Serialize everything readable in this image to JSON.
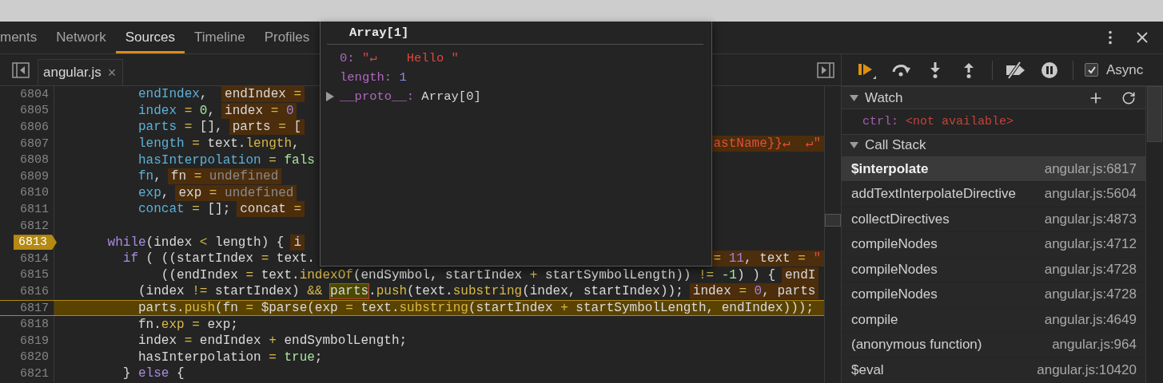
{
  "tabs": [
    {
      "label": "ments",
      "selected": false
    },
    {
      "label": "Network",
      "selected": false
    },
    {
      "label": "Sources",
      "selected": true
    },
    {
      "label": "Timeline",
      "selected": false
    },
    {
      "label": "Profiles",
      "selected": false
    }
  ],
  "file_tab": {
    "name": "angular.js",
    "close": "×"
  },
  "code": [
    {
      "number": "6804",
      "parts": [
        {
          "text": "          endIndex",
          "kind": "decl"
        },
        {
          "text": ", ",
          "kind": "plain"
        },
        {
          "kind": "inline",
          "parts": [
            {
              "text": "endIndex ",
              "kind": "plain"
            },
            {
              "text": "=",
              "kind": "op"
            }
          ]
        }
      ]
    },
    {
      "number": "6805",
      "parts": [
        {
          "text": "          index",
          "kind": "decl"
        },
        {
          "text": " = ",
          "kind": "op"
        },
        {
          "text": "0",
          "kind": "num"
        },
        {
          "text": ",",
          "kind": "plain"
        },
        {
          "kind": "inline",
          "parts": [
            {
              "text": "index ",
              "kind": "plain"
            },
            {
              "text": "= ",
              "kind": "op"
            },
            {
              "text": "0",
              "kind": "inum"
            }
          ]
        }
      ]
    },
    {
      "number": "6806",
      "parts": [
        {
          "text": "          parts",
          "kind": "decl"
        },
        {
          "text": " = ",
          "kind": "op"
        },
        {
          "text": "[],",
          "kind": "plain"
        },
        {
          "kind": "inline",
          "parts": [
            {
              "text": "parts ",
              "kind": "plain"
            },
            {
              "text": "= ",
              "kind": "op"
            },
            {
              "text": "[",
              "kind": "plain"
            }
          ]
        }
      ]
    },
    {
      "number": "6807",
      "parts": [
        {
          "text": "          length",
          "kind": "decl"
        },
        {
          "text": " = ",
          "kind": "op"
        },
        {
          "text": "text.",
          "kind": "plain"
        },
        {
          "text": "length",
          "kind": "prop"
        },
        {
          "text": ",",
          "kind": "plain"
        }
      ],
      "tail": [
        {
          "kind": "inline",
          "parts": [
            {
              "text": "astName}}↵  ↵\"",
              "kind": "str"
            }
          ]
        }
      ]
    },
    {
      "number": "6808",
      "parts": [
        {
          "text": "          hasInterpolation",
          "kind": "decl"
        },
        {
          "text": " = ",
          "kind": "op"
        },
        {
          "text": "fals",
          "kind": "bool"
        }
      ]
    },
    {
      "number": "6809",
      "parts": [
        {
          "text": "          fn",
          "kind": "decl"
        },
        {
          "text": ",",
          "kind": "plain"
        },
        {
          "kind": "inline",
          "parts": [
            {
              "text": "fn ",
              "kind": "plain"
            },
            {
              "text": "= ",
              "kind": "op"
            },
            {
              "text": "undefined",
              "kind": "undef"
            }
          ]
        }
      ]
    },
    {
      "number": "6810",
      "parts": [
        {
          "text": "          exp",
          "kind": "decl"
        },
        {
          "text": ",",
          "kind": "plain"
        },
        {
          "kind": "inline",
          "parts": [
            {
              "text": "exp ",
              "kind": "plain"
            },
            {
              "text": "= ",
              "kind": "op"
            },
            {
              "text": "undefined",
              "kind": "undef"
            }
          ]
        }
      ]
    },
    {
      "number": "6811",
      "parts": [
        {
          "text": "          concat",
          "kind": "decl"
        },
        {
          "text": " = ",
          "kind": "op"
        },
        {
          "text": "[];",
          "kind": "plain"
        },
        {
          "kind": "inline",
          "parts": [
            {
              "text": "concat ",
              "kind": "plain"
            },
            {
              "text": "=",
              "kind": "op"
            }
          ]
        }
      ]
    },
    {
      "number": "6812"
    },
    {
      "number": "6813",
      "breakpoint": true,
      "parts": [
        {
          "text": "      while",
          "kind": "kw"
        },
        {
          "text": "(index ",
          "kind": "plain"
        },
        {
          "text": "< ",
          "kind": "op"
        },
        {
          "text": "length) {",
          "kind": "plain"
        },
        {
          "kind": "inline",
          "parts": [
            {
              "text": "i",
              "kind": "plain"
            }
          ]
        }
      ]
    },
    {
      "number": "6814",
      "parts": [
        {
          "text": "        if",
          "kind": "kw"
        },
        {
          "text": " ( ((startIndex ",
          "kind": "plain"
        },
        {
          "text": "= ",
          "kind": "op"
        },
        {
          "text": "text.",
          "kind": "plain"
        }
      ],
      "tail": [
        {
          "kind": "inline",
          "parts": [
            {
              "text": "= ",
              "kind": "op"
            },
            {
              "text": "11",
              "kind": "inum"
            },
            {
              "text": ", text ",
              "kind": "plain"
            },
            {
              "text": "= ",
              "kind": "op"
            },
            {
              "text": "\"",
              "kind": "str"
            }
          ]
        }
      ]
    },
    {
      "number": "6815",
      "parts": [
        {
          "text": "             ((endIndex ",
          "kind": "plain"
        },
        {
          "text": "= ",
          "kind": "op"
        },
        {
          "text": "text.",
          "kind": "plain"
        },
        {
          "text": "indexOf",
          "kind": "prop"
        },
        {
          "text": "(endSymbol, startIndex ",
          "kind": "plain"
        },
        {
          "text": "+ ",
          "kind": "op"
        },
        {
          "text": "startSymbolLength)) ",
          "kind": "plain"
        },
        {
          "text": "!= ",
          "kind": "op"
        },
        {
          "text": "-1",
          "kind": "num"
        },
        {
          "text": ") ) {",
          "kind": "plain"
        },
        {
          "kind": "inline",
          "parts": [
            {
              "text": "endI",
              "kind": "plain"
            }
          ]
        }
      ]
    },
    {
      "number": "6816",
      "parts": [
        {
          "text": "          (index ",
          "kind": "plain"
        },
        {
          "text": "!= ",
          "kind": "op"
        },
        {
          "text": "startIndex) ",
          "kind": "plain"
        },
        {
          "text": "&& ",
          "kind": "op"
        },
        {
          "kind": "hover",
          "parts": [
            {
              "text": "parts",
              "kind": "plain"
            }
          ]
        },
        {
          "text": ".",
          "kind": "plain"
        },
        {
          "text": "push",
          "kind": "prop"
        },
        {
          "text": "(text.",
          "kind": "plain"
        },
        {
          "text": "substring",
          "kind": "prop"
        },
        {
          "text": "(index, startIndex));",
          "kind": "plain"
        },
        {
          "kind": "inline",
          "parts": [
            {
              "text": "index ",
              "kind": "plain"
            },
            {
              "text": "= ",
              "kind": "op"
            },
            {
              "text": "0",
              "kind": "inum"
            },
            {
              "text": ", parts",
              "kind": "plain"
            }
          ]
        }
      ]
    },
    {
      "number": "6817",
      "current": true,
      "parts": [
        {
          "text": "          parts.",
          "kind": "plain"
        },
        {
          "text": "push",
          "kind": "prop"
        },
        {
          "text": "(fn ",
          "kind": "plain"
        },
        {
          "text": "= ",
          "kind": "op"
        },
        {
          "text": "$parse(exp ",
          "kind": "plain"
        },
        {
          "text": "= ",
          "kind": "op"
        },
        {
          "text": "text.",
          "kind": "plain"
        },
        {
          "text": "substring",
          "kind": "prop"
        },
        {
          "text": "(startIndex ",
          "kind": "plain"
        },
        {
          "text": "+ ",
          "kind": "op"
        },
        {
          "text": "startSymbolLength, endIndex)));",
          "kind": "plain"
        }
      ]
    },
    {
      "number": "6818",
      "parts": [
        {
          "text": "          fn.",
          "kind": "plain"
        },
        {
          "text": "exp",
          "kind": "prop"
        },
        {
          "text": " = ",
          "kind": "op"
        },
        {
          "text": "exp;",
          "kind": "plain"
        }
      ]
    },
    {
      "number": "6819",
      "parts": [
        {
          "text": "          index ",
          "kind": "plain"
        },
        {
          "text": "= ",
          "kind": "op"
        },
        {
          "text": "endIndex ",
          "kind": "plain"
        },
        {
          "text": "+ ",
          "kind": "op"
        },
        {
          "text": "endSymbolLength;",
          "kind": "plain"
        }
      ]
    },
    {
      "number": "6820",
      "parts": [
        {
          "text": "          hasInterpolation ",
          "kind": "plain"
        },
        {
          "text": "= ",
          "kind": "op"
        },
        {
          "text": "true",
          "kind": "bool"
        },
        {
          "text": ";",
          "kind": "plain"
        }
      ]
    },
    {
      "number": "6821",
      "parts": [
        {
          "text": "        } ",
          "kind": "plain"
        },
        {
          "text": "else",
          "kind": "kw"
        },
        {
          "text": " {",
          "kind": "plain"
        }
      ]
    }
  ],
  "popover": {
    "title": "Array[1]",
    "properties": [
      {
        "name": "0:",
        "value": "\"↵    Hello \"",
        "kind": "string",
        "expandable": false
      },
      {
        "name": "length:",
        "value": "1",
        "kind": "number",
        "expandable": false
      },
      {
        "name": "__proto__:",
        "value": "Array[0]",
        "kind": "object",
        "expandable": true
      }
    ]
  },
  "debugger": {
    "async": {
      "label": "Async",
      "checked": true
    }
  },
  "watch": {
    "title": "Watch",
    "expanded": true,
    "items": [
      {
        "name": "ctrl:",
        "value": "<not available>"
      }
    ]
  },
  "call_stack": {
    "title": "Call Stack",
    "expanded": true,
    "frames": [
      {
        "function": "$interpolate",
        "location": "angular.js:6817",
        "selected": true
      },
      {
        "function": "addTextInterpolateDirective",
        "location": "angular.js:5604",
        "selected": false
      },
      {
        "function": "collectDirectives",
        "location": "angular.js:4873",
        "selected": false
      },
      {
        "function": "compileNodes",
        "location": "angular.js:4712",
        "selected": false
      },
      {
        "function": "compileNodes",
        "location": "angular.js:4728",
        "selected": false
      },
      {
        "function": "compileNodes",
        "location": "angular.js:4728",
        "selected": false
      },
      {
        "function": "compile",
        "location": "angular.js:4649",
        "selected": false
      },
      {
        "function": "(anonymous function)",
        "location": "angular.js:964",
        "selected": false
      },
      {
        "function": "$eval",
        "location": "angular.js:10420",
        "selected": false
      }
    ]
  }
}
